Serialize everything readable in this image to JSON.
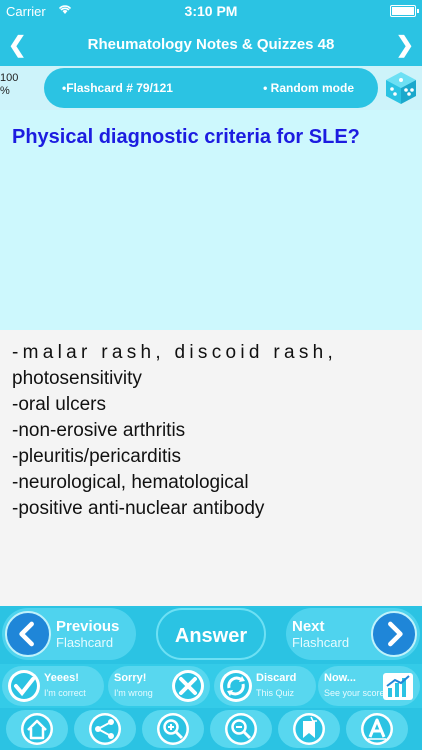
{
  "status_bar": {
    "carrier": "Carrier",
    "time": "3:10 PM"
  },
  "nav": {
    "back_icon": "chevron-left",
    "title": "Rheumatology Notes & Quizzes 48",
    "forward_icon": "chevron-right"
  },
  "info": {
    "progress_line1": "100",
    "progress_line2": "%",
    "flashcard": "•Flashcard #  79/121",
    "mode": "• Random mode",
    "dice_icon": "dice"
  },
  "question": "Physical diagnostic criteria for SLE?",
  "answer_lines": [
    "-malar rash, discoid rash,",
    "photosensitivity",
    "-oral ulcers",
    "-non-erosive arthritis",
    "-pleuritis/pericarditis",
    "-neurological, hematological",
    "-positive anti-nuclear antibody"
  ],
  "controls": {
    "previous": {
      "title": "Previous",
      "sub": "Flashcard"
    },
    "answer": "Answer",
    "next": {
      "title": "Next",
      "sub": "Flashcard"
    }
  },
  "actions": {
    "correct": {
      "title": "Yeees!",
      "sub": "I'm correct"
    },
    "wrong": {
      "title": "Sorry!",
      "sub": "I'm wrong"
    },
    "discard": {
      "title": "Discard",
      "sub": "This Quiz"
    },
    "score": {
      "title": "Now...",
      "sub": "See your score"
    }
  },
  "toolbar_icons": [
    "home",
    "share",
    "zoom-in",
    "zoom-out",
    "bookmark",
    "font"
  ],
  "colors": {
    "primary": "#2bc3e3",
    "question_text": "#1c1ce0",
    "question_bg": "#cdf8fd"
  }
}
